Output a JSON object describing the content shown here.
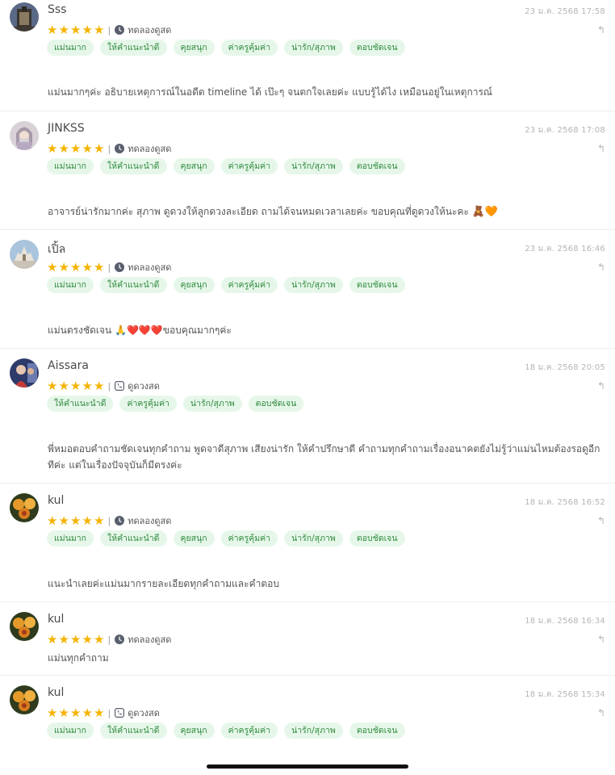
{
  "reviews": [
    {
      "name": "Sss",
      "date": "23 ม.ค. 2568 17:58",
      "service": "ทดลองดูสด",
      "service_icon": "clock-icon",
      "tags": [
        "แม่นมาก",
        "ให้คำแนะนำดี",
        "คุยสนุก",
        "ค่าครูคุ้มค่า",
        "น่ารัก/สุภาพ",
        "ตอบชัดเจน"
      ],
      "text": "แม่นมากๆค่ะ อธิบายเหตุการณ์ในอดีต timeline ได้ เป๊ะๆ จนตกใจเลยค่ะ แบบรู้ได้ไง เหมือนอยู่ในเหตุการณ์",
      "emoji": "",
      "rating": 5
    },
    {
      "name": "JINKSS",
      "date": "23 ม.ค. 2568 17:08",
      "service": "ทดลองดูสด",
      "service_icon": "clock-icon",
      "tags": [
        "แม่นมาก",
        "ให้คำแนะนำดี",
        "คุยสนุก",
        "ค่าครูคุ้มค่า",
        "น่ารัก/สุภาพ",
        "ตอบชัดเจน"
      ],
      "text": "อาจารย์น่ารักมากค่ะ สุภาพ ดูดวงให้ลูกดวงละเอียด ถามได้จนหมดเวลาเลยค่ะ ขอบคุณที่ดูดวงให้นะคะ",
      "emoji": "🧸🧡",
      "rating": 5
    },
    {
      "name": "เปิ้ล",
      "date": "23 ม.ค. 2568 16:46",
      "service": "ทดลองดูสด",
      "service_icon": "clock-icon",
      "tags": [
        "แม่นมาก",
        "ให้คำแนะนำดี",
        "คุยสนุก",
        "ค่าครูคุ้มค่า",
        "น่ารัก/สุภาพ",
        "ตอบชัดเจน"
      ],
      "text": "แม่นตรงชัดเจน 🙏❤️❤️❤️ขอบคุณมากๆค่ะ",
      "emoji": "",
      "rating": 5
    },
    {
      "name": "Aissara",
      "date": "18 ม.ค. 2568 20:05",
      "service": "ดูดวงสด",
      "service_icon": "phone-icon",
      "tags": [
        "ให้คำแนะนำดี",
        "ค่าครูคุ้มค่า",
        "น่ารัก/สุภาพ",
        "ตอบชัดเจน"
      ],
      "text": "พี่หมอตอบคำถามชัดเจนทุกคำถาม พูดจาดีสุภาพ เสียงน่ารัก ให้คำปรึกษาดี คำถามทุกคำถามเรื่องอนาคตยังไม่รู้ว่าแม่นไหมต้องรอดูอีกทีค่ะ แต่ในเรื่องปัจจุบันก็มีตรงค่ะ",
      "emoji": "",
      "rating": 5
    },
    {
      "name": "kul",
      "date": "18 ม.ค. 2568 16:52",
      "service": "ทดลองดูสด",
      "service_icon": "clock-icon",
      "tags": [
        "แม่นมาก",
        "ให้คำแนะนำดี",
        "คุยสนุก",
        "ค่าครูคุ้มค่า",
        "น่ารัก/สุภาพ",
        "ตอบชัดเจน"
      ],
      "text": "แนะนำเลยค่ะแม่นมากรายละเอียดทุกคำถามและคำตอบ",
      "emoji": "",
      "rating": 5
    },
    {
      "name": "kul",
      "date": "18 ม.ค. 2568 16:34",
      "service": "ทดลองดูสด",
      "service_icon": "clock-icon",
      "tags": [],
      "text": "แม่นทุกคำถาม",
      "emoji": "",
      "rating": 5
    },
    {
      "name": "kul",
      "date": "18 ม.ค. 2568 15:34",
      "service": "ดูดวงสด",
      "service_icon": "phone-icon",
      "tags": [
        "แม่นมาก",
        "ให้คำแนะนำดี",
        "คุยสนุก",
        "ค่าครูคุ้มค่า",
        "น่ารัก/สุภาพ",
        "ตอบชัดเจน"
      ],
      "text": "",
      "emoji": "",
      "rating": 5
    }
  ],
  "reply_icon": "reply-arrow-icon",
  "colors": {
    "star": "#f5b301",
    "tag_bg": "#e6f7ea",
    "tag_text": "#2f8a3c",
    "date": "#b5b5b5"
  }
}
